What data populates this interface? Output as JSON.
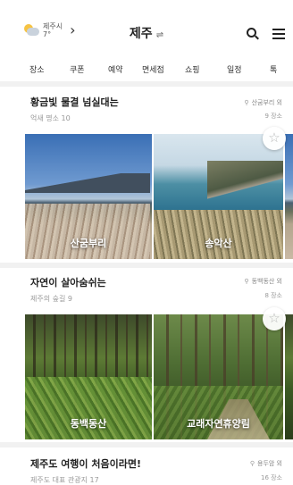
{
  "header": {
    "weather_city": "제주시",
    "weather_temp": "7°",
    "title": "제주",
    "swap_glyph": "⇌"
  },
  "tabs": [
    {
      "label": "장소"
    },
    {
      "label": "쿠폰"
    },
    {
      "label": "예약"
    },
    {
      "label": "면세점"
    },
    {
      "label": "쇼핑"
    },
    {
      "label": "일정"
    },
    {
      "label": "톡"
    }
  ],
  "sections": [
    {
      "title": "황금빛 물결 넘실대는",
      "subtitle": "억새 명소 10",
      "location": "산굼부리 외",
      "count": "9 장소",
      "photos": [
        {
          "label": "산굼부리"
        },
        {
          "label": "송악산"
        }
      ]
    },
    {
      "title": "자연이 살아숨쉬는",
      "subtitle": "제주의 숲길 9",
      "location": "동백동산 외",
      "count": "8 장소",
      "photos": [
        {
          "label": "동백동산"
        },
        {
          "label": "교래자연휴양림"
        }
      ]
    },
    {
      "title": "제주도 여행이 처음이라면!",
      "subtitle": "제주도 대표 관광지 17",
      "location": "용두암 외",
      "count": "16 장소"
    }
  ],
  "icons": {
    "weather": "partly-cloudy-icon",
    "search": "search-icon",
    "menu": "menu-icon",
    "pin": "location-pin-icon",
    "star": "star-icon"
  }
}
